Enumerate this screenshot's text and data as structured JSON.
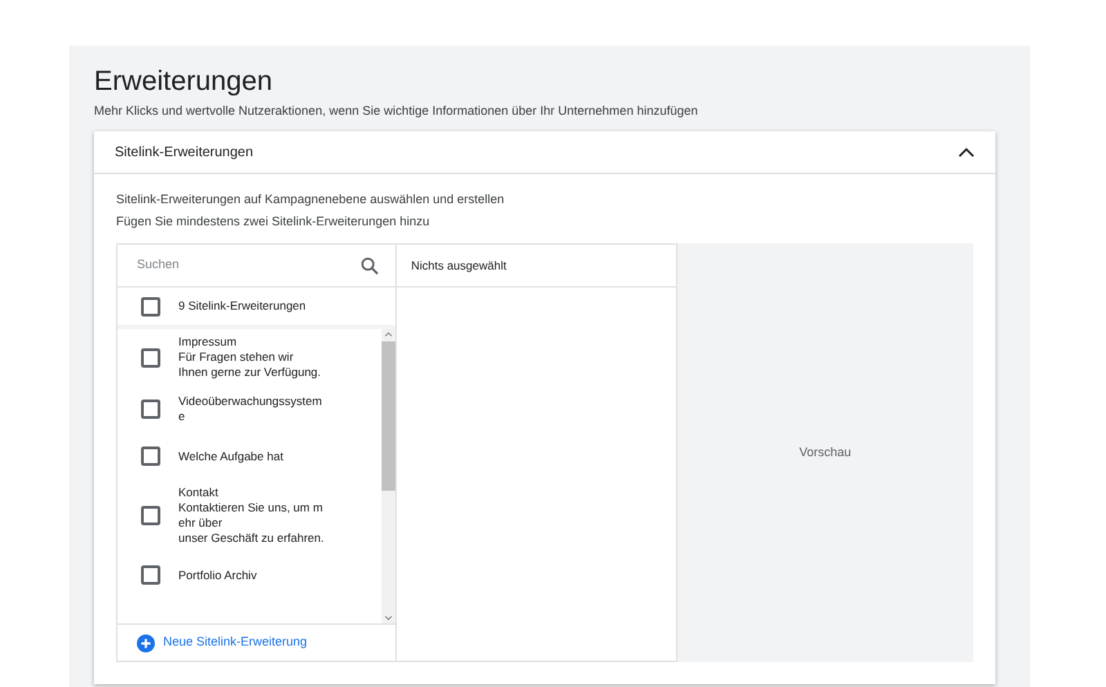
{
  "page": {
    "title": "Erweiterungen",
    "subtitle": "Mehr Klicks und wertvolle Nutzeraktionen, wenn Sie wichtige Informationen über Ihr Unternehmen hinzufügen"
  },
  "card": {
    "title": "Sitelink-Erweiterungen",
    "expanded": true,
    "descriptions": [
      "Sitelink-Erweiterungen auf Kampagnenebene auswählen und erstellen",
      "Fügen Sie mindestens zwei Sitelink-Erweiterungen hinzu"
    ]
  },
  "search": {
    "placeholder": "Suchen"
  },
  "select_all": {
    "label": "9 Sitelink-Erweiterungen",
    "checked": false
  },
  "items": [
    {
      "lines": [
        "Impressum",
        "Für Fragen stehen wir",
        "Ihnen gerne zur Verfügung."
      ],
      "checked": false
    },
    {
      "lines": [
        "Videoüberwachungssystem",
        "e"
      ],
      "checked": false
    },
    {
      "lines": [
        "Welche Aufgabe hat"
      ],
      "checked": false
    },
    {
      "lines": [
        "Kontakt",
        "Kontaktieren Sie uns, um m",
        "ehr über",
        "unser Geschäft zu erfahren."
      ],
      "checked": false
    },
    {
      "lines": [
        "Portfolio Archiv"
      ],
      "checked": false
    }
  ],
  "selected_panel": {
    "label": "Nichts ausgewählt"
  },
  "new_button": {
    "label": "Neue Sitelink-Erweiterung"
  },
  "preview": {
    "label": "Vorschau"
  }
}
